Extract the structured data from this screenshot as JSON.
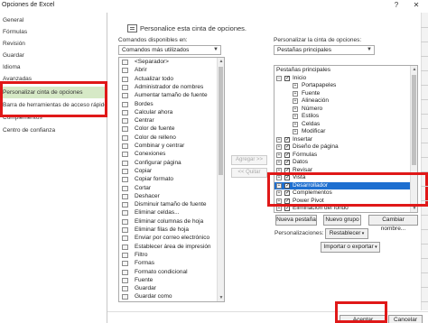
{
  "window": {
    "title": "Opciones de Excel"
  },
  "nav": {
    "items": [
      {
        "label": "General"
      },
      {
        "label": "Fórmulas"
      },
      {
        "label": "Revisión"
      },
      {
        "label": "Guardar"
      },
      {
        "label": "Idioma"
      },
      {
        "label": "Avanzadas"
      },
      {
        "label": "Personalizar cinta de opciones"
      },
      {
        "label": "Barra de herramientas de acceso rápido"
      },
      {
        "label": "Complementos"
      },
      {
        "label": "Centro de confianza"
      }
    ]
  },
  "header": {
    "text": "Personalice esta cinta de opciones."
  },
  "left": {
    "label": "Comandos disponibles en:",
    "combo_value": "Comandos más utilizados",
    "commands": [
      "<Separador>",
      "Abrir",
      "Actualizar todo",
      "Administrador de nombres",
      "Aumentar tamaño de fuente",
      "Bordes",
      "Calcular ahora",
      "Centrar",
      "Color de fuente",
      "Color de relleno",
      "Combinar y centrar",
      "Conexiones",
      "Configurar página",
      "Copiar",
      "Copiar formato",
      "Cortar",
      "Deshacer",
      "Disminuir tamaño de fuente",
      "Eliminar celdas...",
      "Eliminar columnas de hoja",
      "Eliminar filas de hoja",
      "Enviar por correo electrónico",
      "Establecer área de impresión",
      "Filtro",
      "Formas",
      "Formato condicional",
      "Fuente",
      "Guardar",
      "Guardar como"
    ]
  },
  "middle": {
    "add_label": "Agregar >>",
    "remove_label": "<< Quitar"
  },
  "right": {
    "label": "Personalizar la cinta de opciones:",
    "combo_value": "Pestañas principales",
    "tree": [
      {
        "label": "Pestañas principales",
        "level": 0,
        "exp": "",
        "cb": false,
        "header": true
      },
      {
        "label": "Inicio",
        "level": 0,
        "exp": "−",
        "cb": true
      },
      {
        "label": "Portapapeles",
        "level": 1,
        "exp": "+",
        "cb": false
      },
      {
        "label": "Fuente",
        "level": 1,
        "exp": "+",
        "cb": false
      },
      {
        "label": "Alineación",
        "level": 1,
        "exp": "+",
        "cb": false
      },
      {
        "label": "Número",
        "level": 1,
        "exp": "+",
        "cb": false
      },
      {
        "label": "Estilos",
        "level": 1,
        "exp": "+",
        "cb": false
      },
      {
        "label": "Celdas",
        "level": 1,
        "exp": "+",
        "cb": false
      },
      {
        "label": "Modificar",
        "level": 1,
        "exp": "+",
        "cb": false
      },
      {
        "label": "Insertar",
        "level": 0,
        "exp": "+",
        "cb": true
      },
      {
        "label": "Diseño de página",
        "level": 0,
        "exp": "+",
        "cb": true
      },
      {
        "label": "Fórmulas",
        "level": 0,
        "exp": "+",
        "cb": true
      },
      {
        "label": "Datos",
        "level": 0,
        "exp": "+",
        "cb": true
      },
      {
        "label": "Revisar",
        "level": 0,
        "exp": "+",
        "cb": true
      },
      {
        "label": "Vista",
        "level": 0,
        "exp": "+",
        "cb": true
      },
      {
        "label": "Desarrollador",
        "level": 0,
        "exp": "+",
        "cb": true,
        "selected": true
      },
      {
        "label": "Complementos",
        "level": 0,
        "exp": "+",
        "cb": true
      },
      {
        "label": "Power Pivot",
        "level": 0,
        "exp": "+",
        "cb": true
      },
      {
        "label": "Eliminación del fondo",
        "level": 0,
        "exp": "+",
        "cb": true
      }
    ]
  },
  "bottom": {
    "new_tab": "Nueva pestaña",
    "new_group": "Nuevo grupo",
    "rename": "Cambiar nombre...",
    "personalizations_label": "Personalizaciones:",
    "reset": "Restablecer",
    "import_export": "Importar o exportar"
  },
  "footer": {
    "ok": "Aceptar",
    "cancel": "Cancelar"
  },
  "colors": {
    "highlight": "#1e6fd0",
    "red_box": "#e01818",
    "nav_selected": "#d6e9c6"
  }
}
